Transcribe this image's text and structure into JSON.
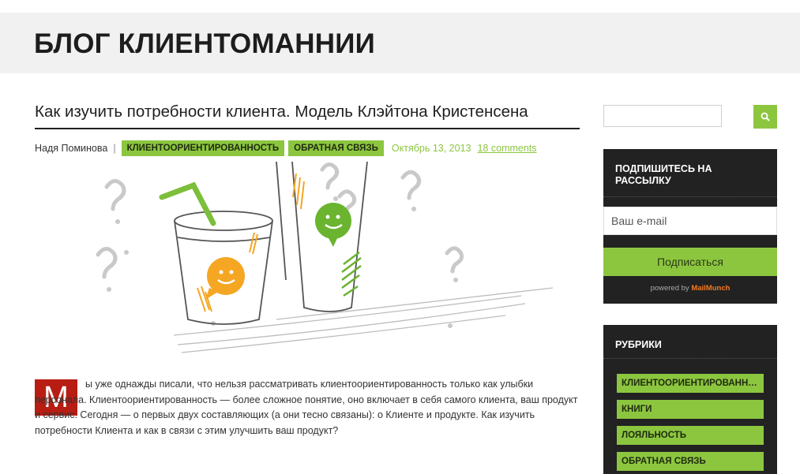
{
  "site": {
    "title": "БЛОГ КЛИЕНТОМАННИИ"
  },
  "post": {
    "title": "Как изучить потребности клиента. Модель Клэйтона Кристенсена",
    "author": "Надя Поминова",
    "separator": "|",
    "tags": [
      "КЛИЕНТООРИЕНТИРОВАННОСТЬ",
      "ОБРАТНАЯ СВЯЗЬ"
    ],
    "date": "Октябрь 13, 2013",
    "comments": "18 comments",
    "dropcap": "М",
    "first_line": "ы уже однажды писали, что нельзя рассматривать клиентоориентированность только как улыбки",
    "rest_text": "персонала. Клиентоориентированность — более сложное понятие, оно включает в себя самого клиента, ваш продукт и сервис. Сегодня — о первых двух составляющих (а они тесно связаны): о Клиенте и продукте. Как изучить потребности Клиента и как в связи с этим улучшить ваш продукт?"
  },
  "sidebar": {
    "search": {
      "value": "",
      "icon": "search-icon"
    },
    "subscribe": {
      "title": "ПОДПИШИТЕСЬ НА РАССЫЛКУ",
      "email_placeholder": "Ваш e-mail",
      "button": "Подписаться",
      "powered_prefix": "powered by",
      "powered_brand": "MailMunch"
    },
    "rubrics": {
      "title": "РУБРИКИ",
      "items": [
        "КЛИЕНТООРИЕНТИРОВАННОСТЬ",
        "КНИГИ",
        "ЛОЯЛЬНОСТЬ",
        "ОБРАТНАЯ СВЯЗЬ"
      ]
    }
  },
  "colors": {
    "accent": "#8cc63f",
    "dark": "#222222",
    "dropcap": "#b71d12",
    "header_bg": "#f1f1f1"
  }
}
